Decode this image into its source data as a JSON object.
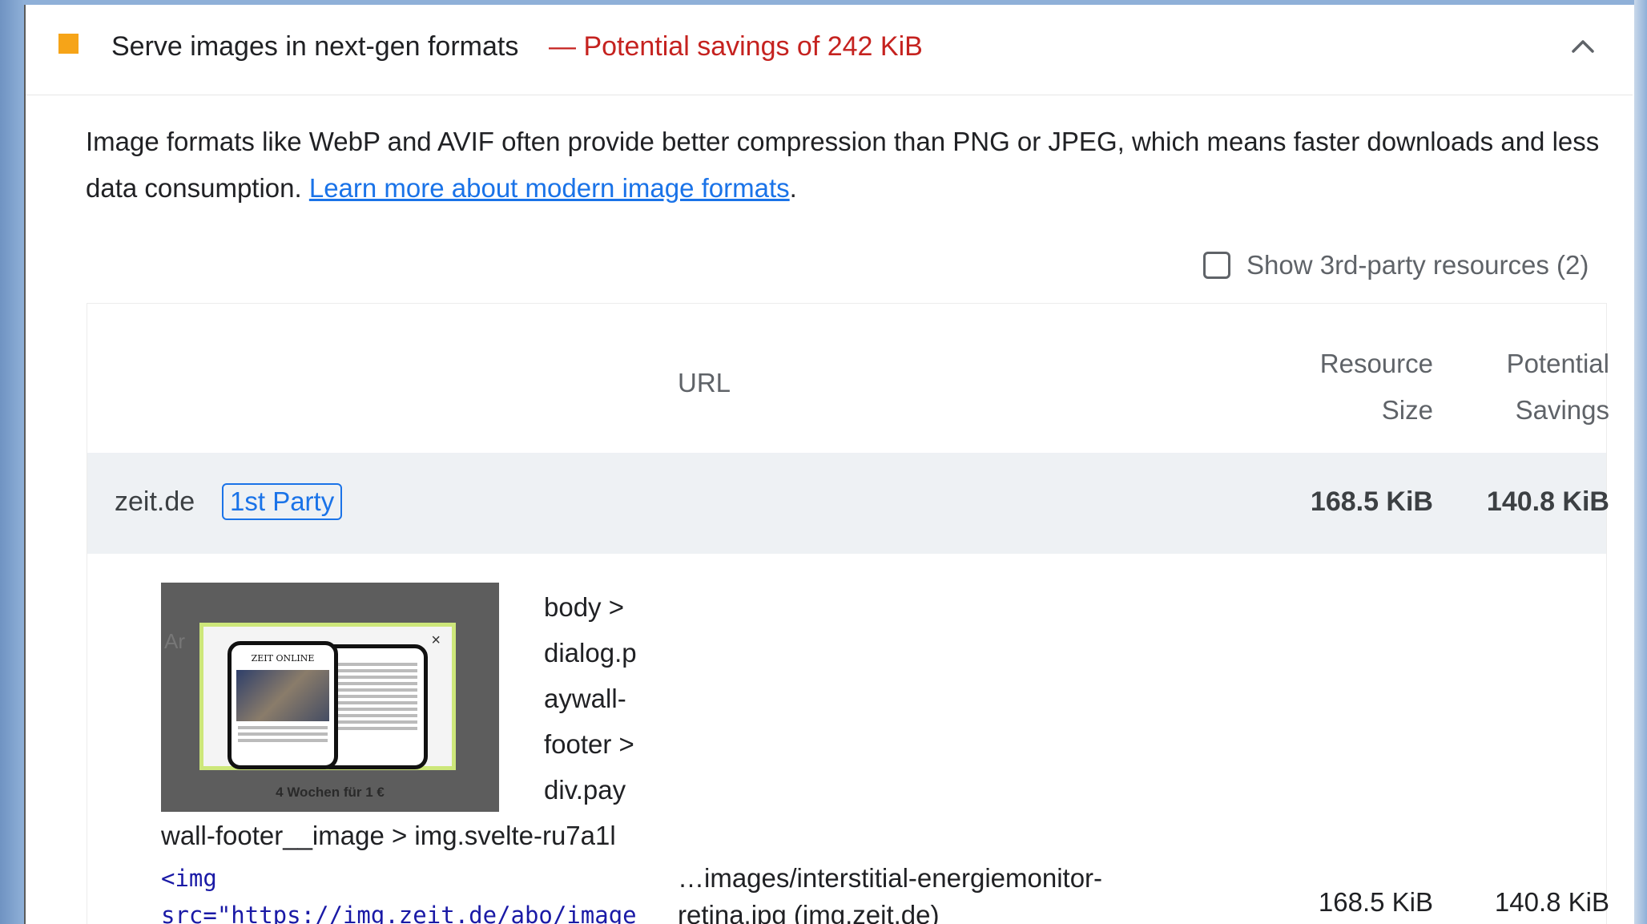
{
  "audit": {
    "title": "Serve images in next-gen formats",
    "savings_text": "— Potential savings of 242 KiB",
    "status_color": "#f6a418",
    "collapse_icon": "chevron-up-icon",
    "description_prefix": "Image formats like WebP and AVIF often provide better compression than PNG or JPEG, which means faster downloads and less data consumption. ",
    "learn_more_label": "Learn more about modern image formats",
    "description_suffix": "."
  },
  "filter": {
    "third_party_label": "Show 3rd-party resources (2)",
    "checked": false
  },
  "table": {
    "columns": {
      "url": "URL",
      "resource_size": "Resource\nSize",
      "potential_savings": "Potential\nSavings"
    },
    "group": {
      "entity": "zeit.de",
      "badge": "1st Party",
      "resource_size": "168.5 KiB",
      "potential_savings": "140.8 KiB"
    },
    "items": [
      {
        "thumbnail": {
          "brand": "ZEIT ONLINE",
          "caption": "4 Wochen für 1 €",
          "close": "×",
          "ghost_text": "Ar"
        },
        "node_path_lines": "body >\ndialog.p\naywall-\nfooter >\ndiv.pay",
        "node_path_tail": "wall-footer__image > img.svelte-ru7a1l",
        "snippet_line1": "<img",
        "snippet_line2": "src=\"https://img.zeit.de/abo/image",
        "url_line1": "…images/interstitial-energiemonitor-",
        "url_line2": "retina.jpg (img.zeit.de)",
        "resource_size": "168.5 KiB",
        "potential_savings": "140.8 KiB"
      }
    ]
  }
}
